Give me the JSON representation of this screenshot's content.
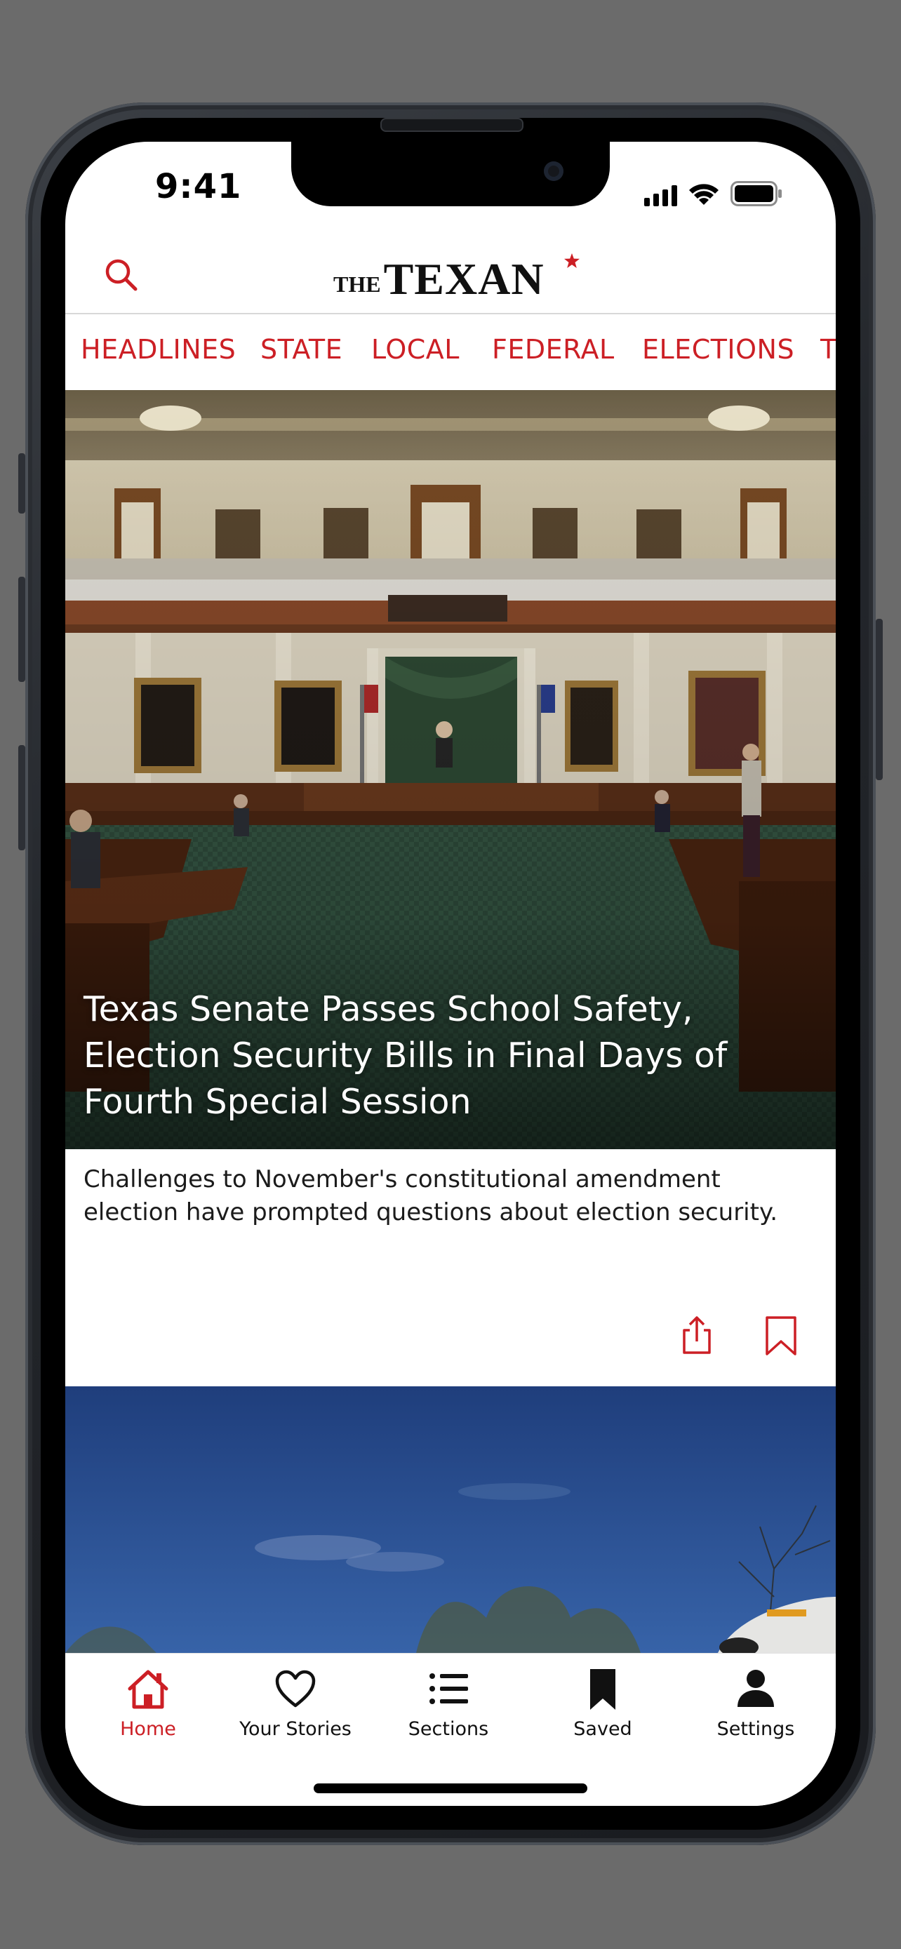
{
  "status_bar": {
    "time": "9:41"
  },
  "header": {
    "logo_small": "THE",
    "logo_main": "TEXAN"
  },
  "categories": [
    "HEADLINES",
    "STATE",
    "LOCAL",
    "FEDERAL",
    "ELECTIONS",
    "T"
  ],
  "featured_story": {
    "headline": "Texas Senate Passes School Safety, Election Security Bills in Final Days of Fourth Special Session",
    "summary": "Challenges to November's constitutional amendment election have prompted questions about election security."
  },
  "tabs": [
    {
      "label": "Home",
      "icon": "home-icon",
      "active": true
    },
    {
      "label": "Your Stories",
      "icon": "heart-icon",
      "active": false
    },
    {
      "label": "Sections",
      "icon": "list-icon",
      "active": false
    },
    {
      "label": "Saved",
      "icon": "bookmark-icon",
      "active": false
    },
    {
      "label": "Settings",
      "icon": "person-icon",
      "active": false
    }
  ],
  "colors": {
    "accent": "#cc1f25",
    "background": "#ffffff",
    "outer_background": "#6b6b6b"
  }
}
